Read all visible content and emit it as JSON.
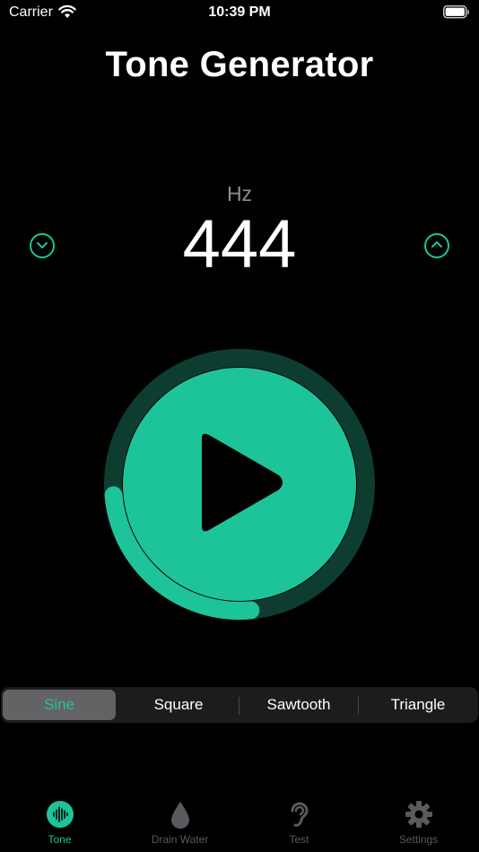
{
  "status_bar": {
    "carrier": "Carrier",
    "time": "10:39 PM"
  },
  "title": "Tone Generator",
  "frequency": {
    "unit": "Hz",
    "value": "444"
  },
  "player": {
    "progress": 0.35
  },
  "waveforms": {
    "options": [
      "Sine",
      "Square",
      "Sawtooth",
      "Triangle"
    ],
    "selected": "Sine"
  },
  "tabs": [
    {
      "label": "Tone",
      "icon": "waveform-icon",
      "active": true
    },
    {
      "label": "Drain Water",
      "icon": "water-drop-icon",
      "active": false
    },
    {
      "label": "Test",
      "icon": "ear-icon",
      "active": false
    },
    {
      "label": "Settings",
      "icon": "gear-icon",
      "active": false
    }
  ],
  "colors": {
    "accent": "#1dc49a",
    "ring_track": "#0d3d31",
    "background": "#000000"
  }
}
